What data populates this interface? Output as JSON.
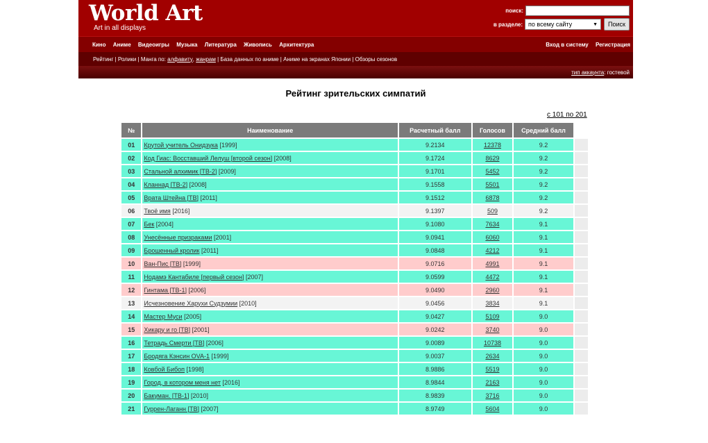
{
  "header": {
    "logo": "World Art",
    "slogan": "Art in all displays",
    "search_label": "поиск:",
    "section_label": "в разделе:",
    "section_value": "по всему сайту",
    "search_button": "Поиск",
    "search_value": ""
  },
  "nav": {
    "main": [
      "Кино",
      "Аниме",
      "Видеоигры",
      "Музыка",
      "Литература",
      "Живопись",
      "Архитектура"
    ],
    "login": "Вход в систему",
    "register": "Регистрация"
  },
  "subnav": {
    "rating": "Рейтинг",
    "clips": "Ролики",
    "manga_prefix": "Манга по:",
    "alphabet": "алфавиту",
    "genres": "жанрам",
    "database": "База данных по аниме",
    "japan_screens": "Аниме на экранах Японии",
    "season_reviews": "Обзоры сезонов",
    "sep": "|",
    "comma": ","
  },
  "account": {
    "link": "тип аккаунта",
    "value": ": гостевой"
  },
  "page": {
    "title": "Рейтинг зрительских симпатий",
    "range": "с 101 по 201"
  },
  "table": {
    "headers": [
      "№",
      "Наименование",
      "Расчетный балл",
      "Голосов",
      "Средний балл"
    ],
    "rows": [
      {
        "n": "01",
        "title": "Крутой учитель Онидзука",
        "year": "[1999]",
        "score": "9.2134",
        "votes": "12378",
        "avg": "9.2",
        "color": "teal"
      },
      {
        "n": "02",
        "title": "Код Гиас: Восставший Лелуш [второй сезон]",
        "year": "[2008]",
        "score": "9.1724",
        "votes": "8629",
        "avg": "9.2",
        "color": "teal"
      },
      {
        "n": "03",
        "title": "Стальной алхимик [ТВ-2]",
        "year": "[2009]",
        "score": "9.1701",
        "votes": "5452",
        "avg": "9.2",
        "color": "teal"
      },
      {
        "n": "04",
        "title": "Кланнад [ТВ-2]",
        "year": "[2008]",
        "score": "9.1558",
        "votes": "5501",
        "avg": "9.2",
        "color": "teal"
      },
      {
        "n": "05",
        "title": "Врата Штейна [ТВ]",
        "year": "[2011]",
        "score": "9.1512",
        "votes": "6878",
        "avg": "9.2",
        "color": "teal"
      },
      {
        "n": "06",
        "title": "Твоё имя",
        "year": "[2016]",
        "score": "9.1397",
        "votes": "509",
        "avg": "9.2",
        "color": "gray"
      },
      {
        "n": "07",
        "title": "Бек",
        "year": "[2004]",
        "score": "9.1080",
        "votes": "7634",
        "avg": "9.1",
        "color": "teal"
      },
      {
        "n": "08",
        "title": "Унесённые призраками",
        "year": "[2001]",
        "score": "9.0941",
        "votes": "6060",
        "avg": "9.1",
        "color": "teal"
      },
      {
        "n": "09",
        "title": "Брошенный кролик",
        "year": "[2011]",
        "score": "9.0848",
        "votes": "4212",
        "avg": "9.1",
        "color": "teal"
      },
      {
        "n": "10",
        "title": "Ван-Пис [ТВ]",
        "year": "[1999]",
        "score": "9.0716",
        "votes": "4991",
        "avg": "9.1",
        "color": "pink"
      },
      {
        "n": "11",
        "title": "Нодамэ Кантабиле [первый сезон]",
        "year": "[2007]",
        "score": "9.0599",
        "votes": "4472",
        "avg": "9.1",
        "color": "teal"
      },
      {
        "n": "12",
        "title": "Гинтама [ТВ-1]",
        "year": "[2006]",
        "score": "9.0490",
        "votes": "2960",
        "avg": "9.1",
        "color": "pink"
      },
      {
        "n": "13",
        "title": "Исчезновение Харухи Судзумии",
        "year": "[2010]",
        "score": "9.0456",
        "votes": "3834",
        "avg": "9.1",
        "color": "gray"
      },
      {
        "n": "14",
        "title": "Мастер Муси",
        "year": "[2005]",
        "score": "9.0427",
        "votes": "5109",
        "avg": "9.0",
        "color": "teal"
      },
      {
        "n": "15",
        "title": "Хикару и го [ТВ]",
        "year": "[2001]",
        "score": "9.0242",
        "votes": "3740",
        "avg": "9.0",
        "color": "pink"
      },
      {
        "n": "16",
        "title": "Тетрадь Смерти [ТВ]",
        "year": "[2006]",
        "score": "9.0089",
        "votes": "10738",
        "avg": "9.0",
        "color": "teal"
      },
      {
        "n": "17",
        "title": "Бродяга Кэнсин OVA-1",
        "year": "[1999]",
        "score": "9.0037",
        "votes": "2634",
        "avg": "9.0",
        "color": "teal"
      },
      {
        "n": "18",
        "title": "Ковбой Бибоп",
        "year": "[1998]",
        "score": "8.9886",
        "votes": "5519",
        "avg": "9.0",
        "color": "teal"
      },
      {
        "n": "19",
        "title": "Город, в котором меня нет",
        "year": "[2016]",
        "score": "8.9844",
        "votes": "2163",
        "avg": "9.0",
        "color": "teal"
      },
      {
        "n": "20",
        "title": "Бакуман. [ТВ-1]",
        "year": "[2010]",
        "score": "8.9839",
        "votes": "3716",
        "avg": "9.0",
        "color": "teal"
      },
      {
        "n": "21",
        "title": "Гуррен-Лаганн [ТВ]",
        "year": "[2007]",
        "score": "8.9749",
        "votes": "5604",
        "avg": "9.0",
        "color": "teal"
      }
    ]
  }
}
